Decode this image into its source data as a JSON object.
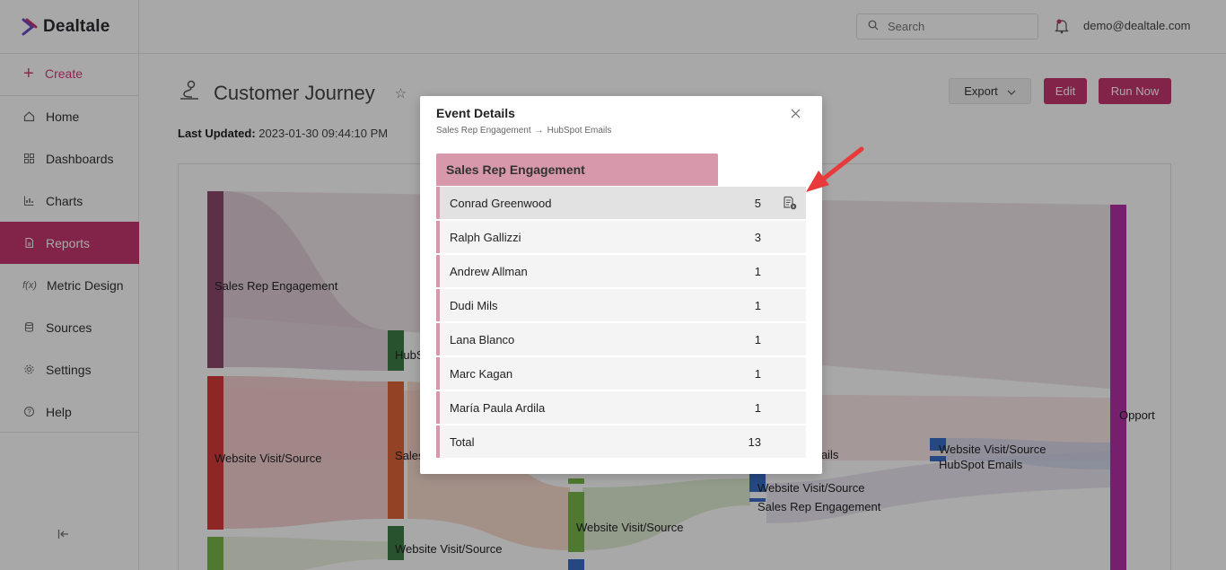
{
  "app": {
    "name": "Dealtale"
  },
  "sidebar": {
    "create_label": "Create",
    "items": [
      {
        "label": "Home",
        "icon": "home-icon",
        "active": false
      },
      {
        "label": "Dashboards",
        "icon": "grid-icon",
        "active": false
      },
      {
        "label": "Charts",
        "icon": "chart-icon",
        "active": false
      },
      {
        "label": "Reports",
        "icon": "document-icon",
        "active": true
      },
      {
        "label": "Metric Design",
        "icon": "function-icon",
        "active": false
      },
      {
        "label": "Sources",
        "icon": "database-icon",
        "active": false
      },
      {
        "label": "Settings",
        "icon": "gear-icon",
        "active": false
      },
      {
        "label": "Help",
        "icon": "help-icon",
        "active": false
      }
    ]
  },
  "topbar": {
    "search_placeholder": "Search",
    "user_email": "demo@dealtale.com"
  },
  "page": {
    "title": "Customer Journey",
    "last_updated_label": "Last Updated:",
    "last_updated_value": "2023-01-30 09:44:10 PM",
    "export_label": "Export",
    "edit_label": "Edit",
    "run_label": "Run Now"
  },
  "chart": {
    "node_labels": [
      "Sales Rep Engagement",
      "Website Visit/Source",
      "HubS",
      "Sales",
      "Website Visit/Source",
      "Website Visit/Source",
      "mails",
      "Website Visit/Source",
      "Sales Rep Engagement",
      "Website Visit/Source",
      "HubSpot Emails",
      "Opport"
    ],
    "colors": {
      "purple": "#8e4a6e",
      "red": "#d83a3a",
      "green": "#78b84a",
      "dark_green": "#3e7d45",
      "orange": "#e0653a",
      "blue": "#3a6ec6",
      "magenta": "#b52fa6"
    }
  },
  "modal": {
    "title": "Event Details",
    "breadcrumb_from": "Sales Rep Engagement",
    "breadcrumb_arrow": "→",
    "breadcrumb_to": "HubSpot Emails",
    "header": "Sales Rep Engagement",
    "rows": [
      {
        "name": "Conrad Greenwood",
        "count": "5"
      },
      {
        "name": "Ralph Gallizzi",
        "count": "3"
      },
      {
        "name": "Andrew Allman",
        "count": "1"
      },
      {
        "name": "Dudi Mils",
        "count": "1"
      },
      {
        "name": "Lana Blanco",
        "count": "1"
      },
      {
        "name": "Marc Kagan",
        "count": "1"
      },
      {
        "name": "María Paula Ardila",
        "count": "1"
      }
    ],
    "total_label": "Total",
    "total_value": "13"
  }
}
